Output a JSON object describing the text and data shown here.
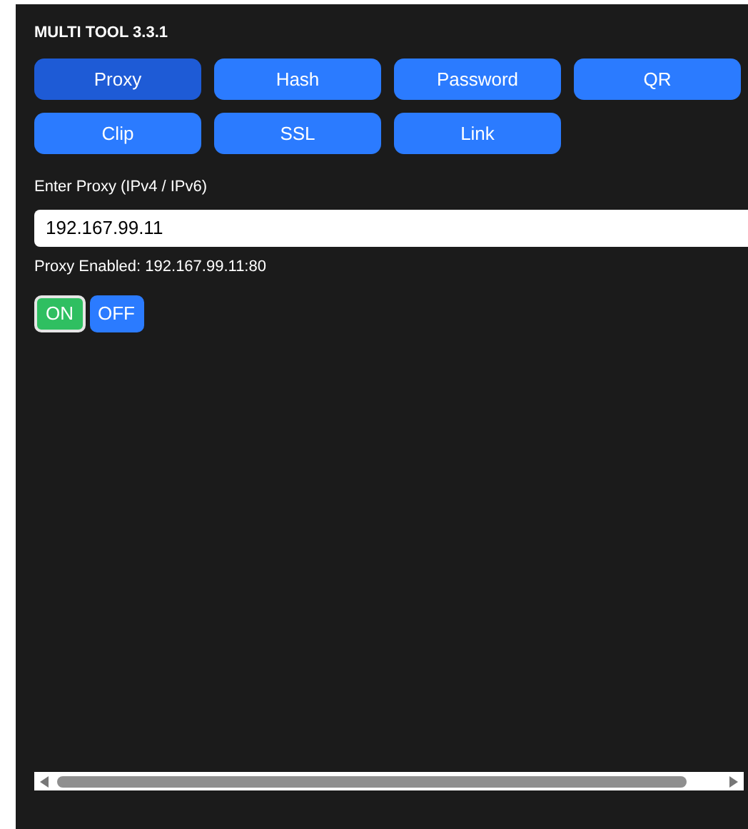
{
  "title": "MULTI TOOL 3.3.1",
  "tabs": [
    {
      "label": "Proxy",
      "selected": true
    },
    {
      "label": "Hash",
      "selected": false
    },
    {
      "label": "Password",
      "selected": false
    },
    {
      "label": "QR",
      "selected": false
    },
    {
      "label": "Clip",
      "selected": false
    },
    {
      "label": "SSL",
      "selected": false
    },
    {
      "label": "Link",
      "selected": false
    }
  ],
  "proxy_field": {
    "label": "Enter Proxy (IPv4 / IPv6)",
    "value": "192.167.99.11"
  },
  "status": "Proxy Enabled: 192.167.99.11:80",
  "toggle": [
    {
      "label": "ON",
      "selected": true
    },
    {
      "label": "OFF",
      "selected": false
    }
  ]
}
